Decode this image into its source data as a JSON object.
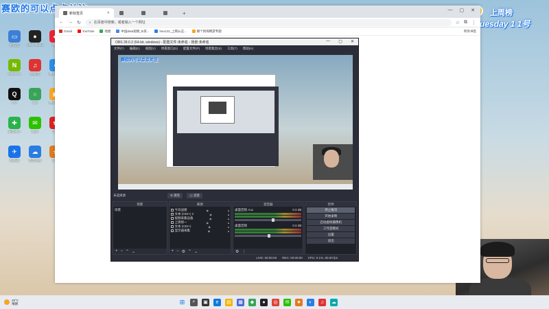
{
  "overlay": {
    "streamer_banner": "赛欧的可以点点关注",
    "deco_title": "上周榜",
    "deco_day": "Tuesday 1 1号"
  },
  "desktop_icons": [
    {
      "label": "此电脑",
      "color": "#3d7fd6",
      "glyph": "▭"
    },
    {
      "label": "OBS Studio",
      "color": "#222",
      "glyph": "●"
    },
    {
      "label": "腾讯",
      "color": "#e23",
      "glyph": "◆"
    },
    {
      "label": "GeForce",
      "color": "#76b900",
      "glyph": "N"
    },
    {
      "label": "网易云",
      "color": "#d33",
      "glyph": "♫"
    },
    {
      "label": "腾讯会议",
      "color": "#2a8ee8",
      "glyph": "◐"
    },
    {
      "label": "QQ",
      "color": "#111",
      "glyph": "Q"
    },
    {
      "label": "360",
      "color": "#3aa35a",
      "glyph": "○"
    },
    {
      "label": "腾讯视频",
      "color": "#f5a623",
      "glyph": "▶"
    },
    {
      "label": "安全中心",
      "color": "#2bb24c",
      "glyph": "✚"
    },
    {
      "label": "微信",
      "color": "#2dc100",
      "glyph": "✉"
    },
    {
      "label": "华为",
      "color": "#d22",
      "glyph": "✿"
    },
    {
      "label": "加速器",
      "color": "#1a73e8",
      "glyph": "✈"
    },
    {
      "label": "百度网盘",
      "color": "#2a7de1",
      "glyph": "☁"
    },
    {
      "label": "游戏",
      "color": "#e07b20",
      "glyph": "★"
    }
  ],
  "browser": {
    "tabs": [
      {
        "title": "新标签页"
      },
      {
        "title": ""
      },
      {
        "title": ""
      },
      {
        "title": ""
      }
    ],
    "new_tab": "+",
    "address_placeholder": "在百度中搜索，或者输入一个网址",
    "bookmarks": [
      {
        "label": "Gmail",
        "color": "#d93025"
      },
      {
        "label": "YouTube",
        "color": "#ff0000"
      },
      {
        "label": "地图",
        "color": "#34a853"
      },
      {
        "label": "中国data观察_bi资...",
        "color": "#4285f4"
      },
      {
        "label": "hao123_上网从这...",
        "color": "#2a7de1"
      },
      {
        "label": "哪个狗嗨网游专题",
        "color": "#f5a623"
      }
    ],
    "other_bookmarks": "所有书签"
  },
  "obs": {
    "title": "OBS 28.0.2 (64-bit, windows) - 配置文件:未命名 - 场景:未命名",
    "menu": [
      "文件(F)",
      "编辑(E)",
      "视图(V)",
      "停靠窗口(D)",
      "配置文件(P)",
      "场景集合(S)",
      "工具(T)",
      "帮助(H)"
    ],
    "preview_title": "赛欧的可以点点关注",
    "toolbar_label": "未选择源",
    "toolbar_props": "属性",
    "toolbar_filters": "滤镜",
    "docks": {
      "scenes_title": "场景",
      "scene_item": "场景",
      "sources_title": "来源",
      "sources": [
        "今日战绩",
        "文本 (GDI+) 2",
        "视频采集设备",
        "上周榜一",
        "文本 (GDI+)",
        "显示器采集"
      ],
      "mixer_title": "混音器",
      "mixer_channels": [
        {
          "name": "桌面音频 Aux",
          "db": "0.0 dB",
          "level": 0.62
        },
        {
          "name": "桌面音频",
          "db": "0.0 dB",
          "level": 0.55
        }
      ],
      "controls_title": "控件",
      "controls": [
        "停止推流",
        "开始录制",
        "启动虚拟摄像机",
        "工作室模式",
        "设置",
        "退出"
      ]
    },
    "status": {
      "live": "LIVE: 00:00:00",
      "rec": "REC: 00:00:00",
      "cpu": "CPU: 0.1%, 60.00 fps"
    }
  },
  "taskbar": {
    "weather_temp": "29°C",
    "weather_desc": "晴朗",
    "icons": [
      {
        "name": "windows-icon",
        "color": "transparent",
        "glyph": "⊞"
      },
      {
        "name": "search-icon",
        "color": "#555",
        "glyph": "⌕"
      },
      {
        "name": "task-view-icon",
        "color": "#333",
        "glyph": "▣"
      },
      {
        "name": "edge-icon",
        "color": "#0f7ad8",
        "glyph": "e"
      },
      {
        "name": "file-explorer-icon",
        "color": "#f5b400",
        "glyph": "▤"
      },
      {
        "name": "store-icon",
        "color": "#4a6ad8",
        "glyph": "▦"
      },
      {
        "name": "app-icon",
        "color": "#3aa35a",
        "glyph": "◆"
      },
      {
        "name": "obs-icon",
        "color": "#222",
        "glyph": "●"
      },
      {
        "name": "chrome-icon",
        "color": "#db4437",
        "glyph": "◎"
      },
      {
        "name": "wechat-icon",
        "color": "#2dc100",
        "glyph": "✉"
      },
      {
        "name": "app2-icon",
        "color": "#e07b20",
        "glyph": "★"
      },
      {
        "name": "app3-icon",
        "color": "#2a7de1",
        "glyph": "◐"
      },
      {
        "name": "app4-icon",
        "color": "#d33",
        "glyph": "♫"
      },
      {
        "name": "app5-icon",
        "color": "#0aa",
        "glyph": "☁"
      }
    ]
  }
}
